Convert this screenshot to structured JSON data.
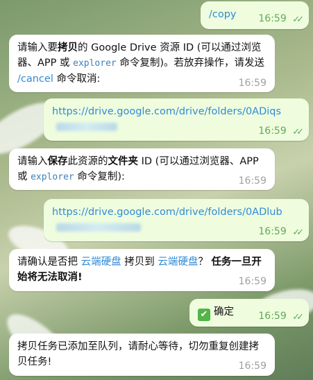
{
  "messages": [
    {
      "text": "/copy",
      "time": "16:59"
    },
    {
      "pre": "请输入要",
      "b1": "拷贝",
      "mid": "的 Google Drive 资源 ID (可以通过浏览器、APP 或 ",
      "code": "explorer",
      "post": " 命令复制)。若放弃操作，请发送 ",
      "cmd": "/cancel",
      "end": " 命令取消:",
      "time": "16:59"
    },
    {
      "url": "https://drive.google.com/drive/folders/0ADiqs",
      "time": "16:59"
    },
    {
      "pre": "请输入",
      "b1": "保存",
      "mid": "此资源的",
      "b2": "文件夹",
      "mid2": " ID (可以通过浏览器、APP 或 ",
      "code": "explorer",
      "end": " 命令复制):",
      "time": "16:59"
    },
    {
      "url": "https://drive.google.com/drive/folders/0ADlub",
      "time": "16:59"
    },
    {
      "pre": "请确认是否把 ",
      "src": "云端硬盘",
      "mid": " 拷贝到 ",
      "dst": "云端硬盘",
      "q": "？ ",
      "bold": "任务一旦开始将无法取消!",
      "time": "16:59"
    },
    {
      "emoji": "✔",
      "text": "确定",
      "time": "16:59"
    },
    {
      "text": "拷贝任务已添加至队列，请耐心等待，切勿重复创建拷贝任务!",
      "time": "16:59"
    }
  ],
  "colors": {
    "link": "#2f8bd6",
    "out_bg": "#effdde",
    "in_bg": "#ffffff",
    "checks": "#5fa95a"
  },
  "icons": [
    "double-check-icon",
    "check-mark-emoji"
  ]
}
